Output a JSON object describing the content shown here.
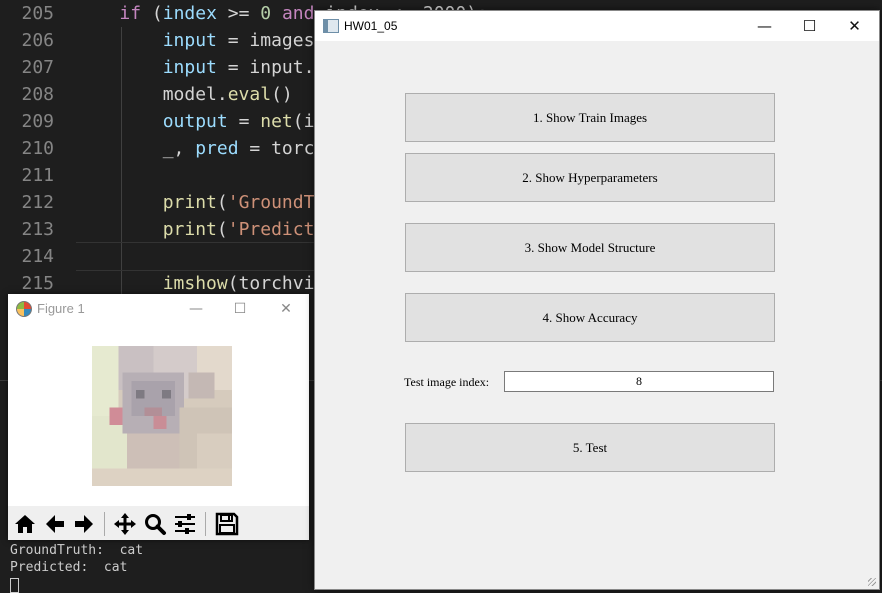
{
  "editor": {
    "lines": [
      {
        "num": "205",
        "parts": [
          [
            "    ",
            ""
          ],
          [
            "if",
            "kw"
          ],
          [
            " (",
            ""
          ],
          [
            "index",
            "var"
          ],
          [
            " >= ",
            ""
          ],
          [
            "0",
            "num"
          ],
          [
            " ",
            ""
          ],
          [
            "and",
            "kw"
          ],
          [
            " index <  2000):",
            ""
          ]
        ]
      },
      {
        "num": "206",
        "parts": [
          [
            "        ",
            ""
          ],
          [
            "input",
            "var"
          ],
          [
            " = images",
            ""
          ]
        ]
      },
      {
        "num": "207",
        "parts": [
          [
            "        ",
            ""
          ],
          [
            "input",
            "var"
          ],
          [
            " = input.",
            ""
          ]
        ]
      },
      {
        "num": "208",
        "parts": [
          [
            "        model.",
            ""
          ],
          [
            "eval",
            "fn"
          ],
          [
            "()",
            ""
          ]
        ]
      },
      {
        "num": "209",
        "parts": [
          [
            "        ",
            ""
          ],
          [
            "output",
            "var"
          ],
          [
            " = ",
            ""
          ],
          [
            "net",
            "fn"
          ],
          [
            "(i",
            ""
          ]
        ]
      },
      {
        "num": "210",
        "parts": [
          [
            "        _, ",
            ""
          ],
          [
            "pred",
            "var"
          ],
          [
            " = torc",
            ""
          ]
        ]
      },
      {
        "num": "211",
        "parts": []
      },
      {
        "num": "212",
        "parts": [
          [
            "        ",
            ""
          ],
          [
            "print",
            "fn"
          ],
          [
            "(",
            ""
          ],
          [
            "'GroundT",
            "str"
          ]
        ]
      },
      {
        "num": "213",
        "parts": [
          [
            "        ",
            ""
          ],
          [
            "print",
            "fn"
          ],
          [
            "(",
            ""
          ],
          [
            "'Predict",
            "str"
          ]
        ]
      },
      {
        "num": "214",
        "parts": []
      },
      {
        "num": "215",
        "parts": [
          [
            "        ",
            ""
          ],
          [
            "imshow",
            "fn"
          ],
          [
            "(torchvi",
            ""
          ]
        ]
      }
    ]
  },
  "terminal": {
    "lines": [
      "GroundTruth:  cat",
      "Predicted:  cat"
    ]
  },
  "figure": {
    "title": "Figure 1",
    "toolbar": [
      "home-icon",
      "back-icon",
      "forward-icon",
      "pan-icon",
      "zoom-icon",
      "configure-icon",
      "save-icon"
    ]
  },
  "hw": {
    "title": "HW01_05",
    "buttons": {
      "train_images": "1. Show Train Images",
      "hyperparameters": "2. Show Hyperparameters",
      "model_structure": "3. Show Model Structure",
      "accuracy": "4. Show Accuracy",
      "test": "5. Test"
    },
    "test_index_label": "Test image index:",
    "test_index_value": "8"
  },
  "colors": {
    "editor_bg": "#1e1e1e",
    "window_bg": "#f0f0f0",
    "button_bg": "#e1e1e1",
    "keyword": "#c586c0",
    "string": "#ce9178",
    "number": "#b5cea8",
    "function": "#dcdcaa"
  }
}
